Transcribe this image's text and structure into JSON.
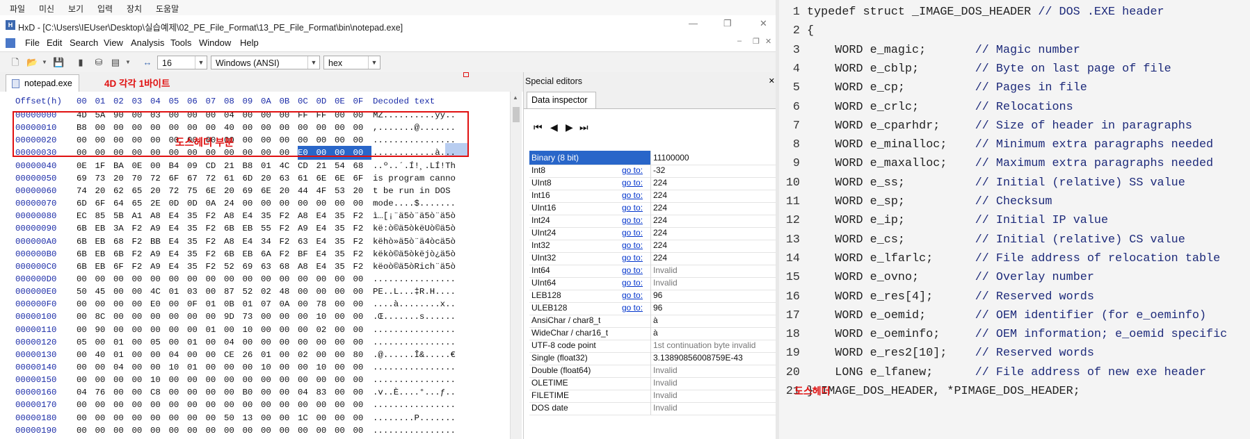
{
  "os_menu": [
    "파일",
    "미신",
    "보기",
    "입력",
    "장치",
    "도움말"
  ],
  "window": {
    "title": "HxD - [C:\\Users\\IEUser\\Desktop\\실습예제\\02_PE_File_Format\\13_PE_File_Format\\bin\\notepad.exe]"
  },
  "menu": [
    "File",
    "Edit",
    "Search",
    "View",
    "Analysis",
    "Tools",
    "Window",
    "Help"
  ],
  "toolbar": {
    "bytes_per_row": "16",
    "charset": "Windows (ANSI)",
    "display": "hex"
  },
  "file_tab": "notepad.exe",
  "annotations": {
    "byte_note": "4D 각각 1바이트",
    "dos_header_label": "도스헤더 부분",
    "code_note": "도스헤더"
  },
  "hex": {
    "header_offset": "Offset(h)",
    "header_cols": [
      "00",
      "01",
      "02",
      "03",
      "04",
      "05",
      "06",
      "07",
      "08",
      "09",
      "0A",
      "0B",
      "0C",
      "0D",
      "0E",
      "0F"
    ],
    "header_decoded": "Decoded text",
    "rows": [
      {
        "off": "00000000",
        "bytes": [
          "4D",
          "5A",
          "90",
          "00",
          "03",
          "00",
          "00",
          "00",
          "04",
          "00",
          "00",
          "00",
          "FF",
          "FF",
          "00",
          "00"
        ],
        "text": "MZ..........ÿÿ.."
      },
      {
        "off": "00000010",
        "bytes": [
          "B8",
          "00",
          "00",
          "00",
          "00",
          "00",
          "00",
          "00",
          "40",
          "00",
          "00",
          "00",
          "00",
          "00",
          "00",
          "00"
        ],
        "text": ",.......@......."
      },
      {
        "off": "00000020",
        "bytes": [
          "00",
          "00",
          "00",
          "00",
          "00",
          "00",
          "00",
          "00",
          "00",
          "00",
          "00",
          "00",
          "00",
          "00",
          "00",
          "00"
        ],
        "text": "................"
      },
      {
        "off": "00000030",
        "bytes": [
          "00",
          "00",
          "00",
          "00",
          "00",
          "00",
          "00",
          "00",
          "00",
          "00",
          "00",
          "00",
          "E0",
          "00",
          "00",
          "00"
        ],
        "text": "............à..."
      },
      {
        "off": "00000040",
        "bytes": [
          "0E",
          "1F",
          "BA",
          "0E",
          "00",
          "B4",
          "09",
          "CD",
          "21",
          "B8",
          "01",
          "4C",
          "CD",
          "21",
          "54",
          "68"
        ],
        "text": "..º..´.Í!¸.LÍ!Th"
      },
      {
        "off": "00000050",
        "bytes": [
          "69",
          "73",
          "20",
          "70",
          "72",
          "6F",
          "67",
          "72",
          "61",
          "6D",
          "20",
          "63",
          "61",
          "6E",
          "6E",
          "6F"
        ],
        "text": "is program canno"
      },
      {
        "off": "00000060",
        "bytes": [
          "74",
          "20",
          "62",
          "65",
          "20",
          "72",
          "75",
          "6E",
          "20",
          "69",
          "6E",
          "20",
          "44",
          "4F",
          "53",
          "20"
        ],
        "text": "t be run in DOS "
      },
      {
        "off": "00000070",
        "bytes": [
          "6D",
          "6F",
          "64",
          "65",
          "2E",
          "0D",
          "0D",
          "0A",
          "24",
          "00",
          "00",
          "00",
          "00",
          "00",
          "00",
          "00"
        ],
        "text": "mode....$......."
      },
      {
        "off": "00000080",
        "bytes": [
          "EC",
          "85",
          "5B",
          "A1",
          "A8",
          "E4",
          "35",
          "F2",
          "A8",
          "E4",
          "35",
          "F2",
          "A8",
          "E4",
          "35",
          "F2"
        ],
        "text": "ì…[¡¨ä5ò¨ä5ò¨ä5ò"
      },
      {
        "off": "00000090",
        "bytes": [
          "6B",
          "EB",
          "3A",
          "F2",
          "A9",
          "E4",
          "35",
          "F2",
          "6B",
          "EB",
          "55",
          "F2",
          "A9",
          "E4",
          "35",
          "F2"
        ],
        "text": "kë:ò©ä5òkëUò©ä5ò"
      },
      {
        "off": "000000A0",
        "bytes": [
          "6B",
          "EB",
          "68",
          "F2",
          "BB",
          "E4",
          "35",
          "F2",
          "A8",
          "E4",
          "34",
          "F2",
          "63",
          "E4",
          "35",
          "F2"
        ],
        "text": "këhò»ä5ò¨ä4òcä5ò"
      },
      {
        "off": "000000B0",
        "bytes": [
          "6B",
          "EB",
          "6B",
          "F2",
          "A9",
          "E4",
          "35",
          "F2",
          "6B",
          "EB",
          "6A",
          "F2",
          "BF",
          "E4",
          "35",
          "F2"
        ],
        "text": "këkò©ä5òkëjò¿ä5ò"
      },
      {
        "off": "000000C0",
        "bytes": [
          "6B",
          "EB",
          "6F",
          "F2",
          "A9",
          "E4",
          "35",
          "F2",
          "52",
          "69",
          "63",
          "68",
          "A8",
          "E4",
          "35",
          "F2"
        ],
        "text": "këoò©ä5òRich¨ä5ò"
      },
      {
        "off": "000000D0",
        "bytes": [
          "00",
          "00",
          "00",
          "00",
          "00",
          "00",
          "00",
          "00",
          "00",
          "00",
          "00",
          "00",
          "00",
          "00",
          "00",
          "00"
        ],
        "text": "................"
      },
      {
        "off": "000000E0",
        "bytes": [
          "50",
          "45",
          "00",
          "00",
          "4C",
          "01",
          "03",
          "00",
          "87",
          "52",
          "02",
          "48",
          "00",
          "00",
          "00",
          "00"
        ],
        "text": "PE..L...‡R.H...."
      },
      {
        "off": "000000F0",
        "bytes": [
          "00",
          "00",
          "00",
          "00",
          "E0",
          "00",
          "0F",
          "01",
          "0B",
          "01",
          "07",
          "0A",
          "00",
          "78",
          "00",
          "00"
        ],
        "text": "....à........x.."
      },
      {
        "off": "00000100",
        "bytes": [
          "00",
          "8C",
          "00",
          "00",
          "00",
          "00",
          "00",
          "00",
          "9D",
          "73",
          "00",
          "00",
          "00",
          "10",
          "00",
          "00"
        ],
        "text": ".Œ.......s......"
      },
      {
        "off": "00000110",
        "bytes": [
          "00",
          "90",
          "00",
          "00",
          "00",
          "00",
          "00",
          "01",
          "00",
          "10",
          "00",
          "00",
          "00",
          "02",
          "00",
          "00"
        ],
        "text": "................"
      },
      {
        "off": "00000120",
        "bytes": [
          "05",
          "00",
          "01",
          "00",
          "05",
          "00",
          "01",
          "00",
          "04",
          "00",
          "00",
          "00",
          "00",
          "00",
          "00",
          "00"
        ],
        "text": "................"
      },
      {
        "off": "00000130",
        "bytes": [
          "00",
          "40",
          "01",
          "00",
          "00",
          "04",
          "00",
          "00",
          "CE",
          "26",
          "01",
          "00",
          "02",
          "00",
          "00",
          "80"
        ],
        "text": ".@......Î&.....€"
      },
      {
        "off": "00000140",
        "bytes": [
          "00",
          "00",
          "04",
          "00",
          "00",
          "10",
          "01",
          "00",
          "00",
          "00",
          "10",
          "00",
          "00",
          "10",
          "00",
          "00"
        ],
        "text": "................"
      },
      {
        "off": "00000150",
        "bytes": [
          "00",
          "00",
          "00",
          "00",
          "10",
          "00",
          "00",
          "00",
          "00",
          "00",
          "00",
          "00",
          "00",
          "00",
          "00",
          "00"
        ],
        "text": "................"
      },
      {
        "off": "00000160",
        "bytes": [
          "04",
          "76",
          "00",
          "00",
          "C8",
          "00",
          "00",
          "00",
          "00",
          "B0",
          "00",
          "00",
          "04",
          "83",
          "00",
          "00"
        ],
        "text": ".v..È....°...ƒ.."
      },
      {
        "off": "00000170",
        "bytes": [
          "00",
          "00",
          "00",
          "00",
          "00",
          "00",
          "00",
          "00",
          "00",
          "00",
          "00",
          "00",
          "00",
          "00",
          "00",
          "00"
        ],
        "text": "................"
      },
      {
        "off": "00000180",
        "bytes": [
          "00",
          "00",
          "00",
          "00",
          "00",
          "00",
          "00",
          "00",
          "50",
          "13",
          "00",
          "00",
          "1C",
          "00",
          "00",
          "00"
        ],
        "text": "........P......."
      },
      {
        "off": "00000190",
        "bytes": [
          "00",
          "00",
          "00",
          "00",
          "00",
          "00",
          "00",
          "00",
          "00",
          "00",
          "00",
          "00",
          "00",
          "00",
          "00",
          "00"
        ],
        "text": "................"
      }
    ]
  },
  "special_editors": {
    "title": "Special editors",
    "tab": "Data inspector",
    "goto_label": "go to:",
    "rows": [
      {
        "name": "Binary (8 bit)",
        "goto": false,
        "value": "11100000",
        "selected": true
      },
      {
        "name": "Int8",
        "goto": true,
        "value": "-32"
      },
      {
        "name": "UInt8",
        "goto": true,
        "value": "224"
      },
      {
        "name": "Int16",
        "goto": true,
        "value": "224"
      },
      {
        "name": "UInt16",
        "goto": true,
        "value": "224"
      },
      {
        "name": "Int24",
        "goto": true,
        "value": "224"
      },
      {
        "name": "UInt24",
        "goto": true,
        "value": "224"
      },
      {
        "name": "Int32",
        "goto": true,
        "value": "224"
      },
      {
        "name": "UInt32",
        "goto": true,
        "value": "224"
      },
      {
        "name": "Int64",
        "goto": true,
        "value": "Invalid",
        "gray": true
      },
      {
        "name": "UInt64",
        "goto": true,
        "value": "Invalid",
        "gray": true
      },
      {
        "name": "LEB128",
        "goto": true,
        "value": "96"
      },
      {
        "name": "ULEB128",
        "goto": true,
        "value": "96"
      },
      {
        "name": "AnsiChar / char8_t",
        "goto": false,
        "value": "à"
      },
      {
        "name": "WideChar / char16_t",
        "goto": false,
        "value": "à"
      },
      {
        "name": "UTF-8 code point",
        "goto": false,
        "value": "1st continuation byte invalid",
        "gray": true
      },
      {
        "name": "Single (float32)",
        "goto": false,
        "value": "3.13890856008759E-43"
      },
      {
        "name": "Double (float64)",
        "goto": false,
        "value": "Invalid",
        "gray": true
      },
      {
        "name": "OLETIME",
        "goto": false,
        "value": "Invalid",
        "gray": true
      },
      {
        "name": "FILETIME",
        "goto": false,
        "value": "Invalid",
        "gray": true
      },
      {
        "name": "DOS date",
        "goto": false,
        "value": "Invalid",
        "gray": true
      }
    ]
  },
  "code": {
    "lines": [
      {
        "n": "1",
        "a": "typedef struct _IMAGE_DOS_HEADER ",
        "c": "// DOS .EXE header"
      },
      {
        "n": "2",
        "a": "{",
        "c": ""
      },
      {
        "n": "3",
        "a": "    WORD e_magic;       ",
        "c": "// Magic number"
      },
      {
        "n": "4",
        "a": "    WORD e_cblp;        ",
        "c": "// Byte on last page of file"
      },
      {
        "n": "5",
        "a": "    WORD e_cp;          ",
        "c": "// Pages in file"
      },
      {
        "n": "6",
        "a": "    WORD e_crlc;        ",
        "c": "// Relocations"
      },
      {
        "n": "7",
        "a": "    WORD e_cparhdr;     ",
        "c": "// Size of header in paragraphs"
      },
      {
        "n": "8",
        "a": "    WORD e_minalloc;    ",
        "c": "// Minimum extra paragraphs needed"
      },
      {
        "n": "9",
        "a": "    WORD e_maxalloc;    ",
        "c": "// Maximum extra paragraphs needed"
      },
      {
        "n": "10",
        "a": "    WORD e_ss;          ",
        "c": "// Initial (relative) SS value"
      },
      {
        "n": "11",
        "a": "    WORD e_sp;          ",
        "c": "// Checksum"
      },
      {
        "n": "12",
        "a": "    WORD e_ip;          ",
        "c": "// Initial IP value"
      },
      {
        "n": "13",
        "a": "    WORD e_cs;          ",
        "c": "// Initial (relative) CS value"
      },
      {
        "n": "14",
        "a": "    WORD e_lfarlc;      ",
        "c": "// File address of relocation table"
      },
      {
        "n": "15",
        "a": "    WORD e_ovno;        ",
        "c": "// Overlay number"
      },
      {
        "n": "16",
        "a": "    WORD e_res[4];      ",
        "c": "// Reserved words"
      },
      {
        "n": "17",
        "a": "    WORD e_oemid;       ",
        "c": "// OEM identifier (for e_oeminfo)"
      },
      {
        "n": "18",
        "a": "    WORD e_oeminfo;     ",
        "c": "// OEM information; e_oemid specific"
      },
      {
        "n": "19",
        "a": "    WORD e_res2[10];    ",
        "c": "// Reserved words"
      },
      {
        "n": "20",
        "a": "    LONG e_lfanew;      ",
        "c": "// File address of new exe header"
      },
      {
        "n": "21",
        "a": "} IMAGE_DOS_HEADER, *PIMAGE_DOS_HEADER;",
        "c": ""
      }
    ]
  }
}
